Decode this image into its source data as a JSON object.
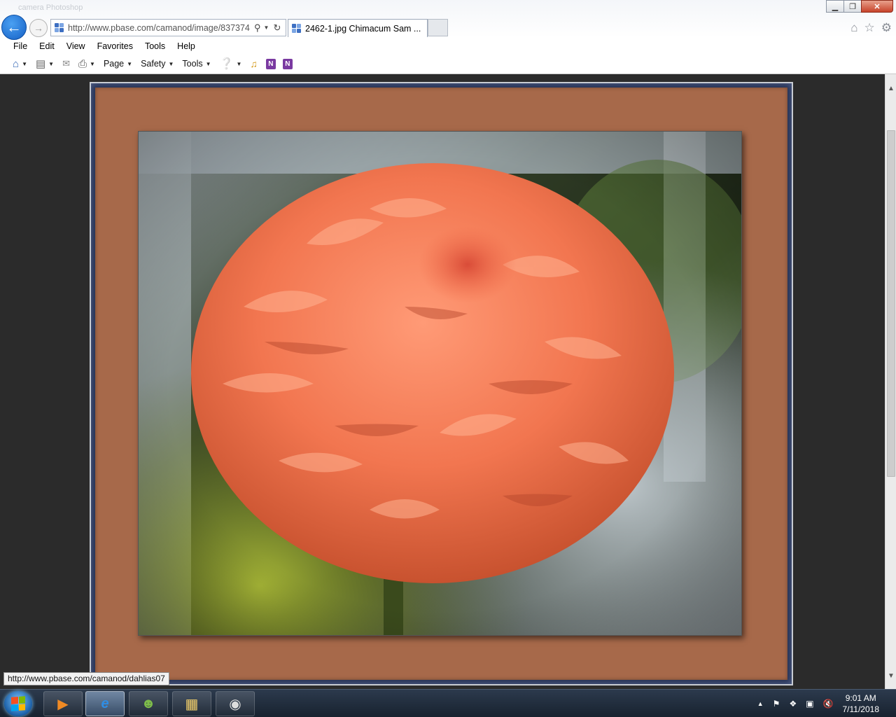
{
  "window": {
    "ghost_title": "camera Photoshop",
    "controls": {
      "minimize": "▁",
      "restore": "❐",
      "close": "✕"
    }
  },
  "address_bar": {
    "url": "http://www.pbase.com/camanod/image/837374"
  },
  "tab": {
    "title": "2462-1.jpg Chimacum Sam ..."
  },
  "menu": [
    "File",
    "Edit",
    "View",
    "Favorites",
    "Tools",
    "Help"
  ],
  "command_bar": {
    "page": "Page",
    "safety": "Safety",
    "tools": "Tools"
  },
  "status_tooltip": "http://www.pbase.com/camanod/dahlias07",
  "clock": {
    "time": "9:01 AM",
    "date": "7/11/2018"
  },
  "colors": {
    "page_bg": "#2b2b2b",
    "frame_blue": "#253154",
    "mat_brown": "#a7694a",
    "flower": "#f27650",
    "accent_blue": "#1560c5"
  },
  "icons": {
    "back": "back-arrow-icon",
    "forward": "forward-arrow-icon",
    "home": "home-icon",
    "favorites": "star-icon",
    "settings": "gear-icon"
  }
}
